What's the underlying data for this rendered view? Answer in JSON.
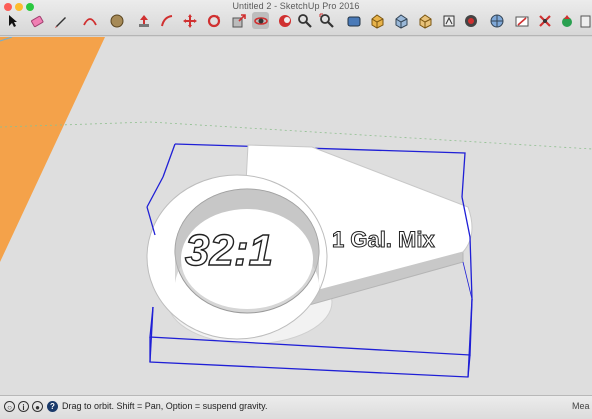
{
  "window": {
    "title": "Untitled 2 - SketchUp Pro 2016"
  },
  "toolbar": {
    "tools": [
      {
        "name": "select-icon"
      },
      {
        "name": "eraser-icon"
      },
      {
        "name": "pencil-icon"
      },
      {
        "name": "arc-icon"
      },
      {
        "name": "shapes-icon"
      },
      {
        "name": "push-pull-icon"
      },
      {
        "name": "follow-me-icon"
      },
      {
        "name": "move-icon"
      },
      {
        "name": "rotate-icon"
      },
      {
        "name": "scale-icon"
      },
      {
        "name": "orbit-icon",
        "active": true
      },
      {
        "name": "pan-icon"
      },
      {
        "name": "zoom-icon"
      },
      {
        "name": "zoom-extents-icon"
      },
      {
        "name": "tape-measure-icon"
      },
      {
        "name": "paint-bucket-icon"
      },
      {
        "name": "component-icon"
      },
      {
        "name": "warehouse-icon"
      },
      {
        "name": "iso-view-icon"
      },
      {
        "name": "top-view-icon"
      },
      {
        "name": "front-view-icon"
      },
      {
        "name": "styles-icon"
      },
      {
        "name": "x-ray-icon"
      },
      {
        "name": "geo-location-icon"
      },
      {
        "name": "section-plane-icon"
      },
      {
        "name": "extension-warehouse-icon"
      },
      {
        "name": "intersect-icon"
      },
      {
        "name": "sandbox-icon"
      }
    ]
  },
  "model": {
    "text_main": "32:1",
    "text_side": "1 Gal. Mix",
    "selection_color": "#1f1fd6",
    "surface_color": "#ffffff",
    "plane_color": "#f4a24a"
  },
  "statusbar": {
    "hint": "Drag to orbit. Shift = Pan, Option = suspend gravity.",
    "measurements_label": "Mea"
  }
}
